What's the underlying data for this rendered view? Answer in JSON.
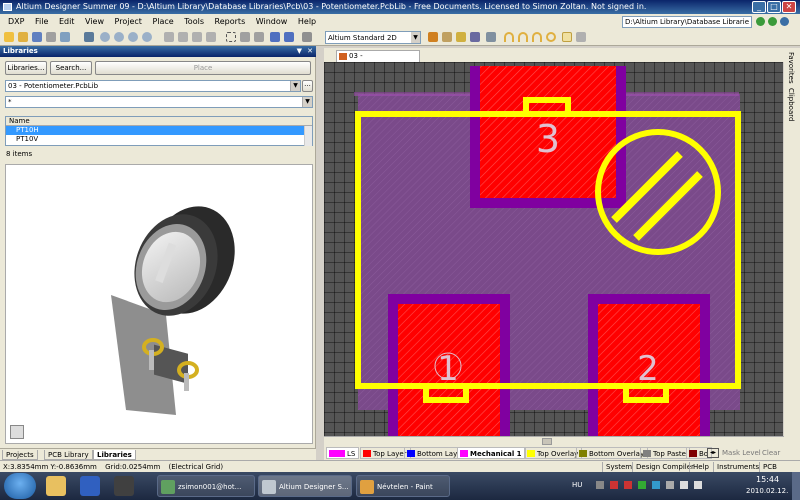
{
  "window": {
    "title": "Altium Designer Summer 09 - D:\\Altium Library\\Database Libraries\\Pcb\\03 - Potentiometer.PcbLib - Free Documents. Licensed to Simon Zoltan. Not signed in.",
    "path_box": "D:\\Altium Library\\Database Librarie"
  },
  "menu": [
    "DXP",
    "File",
    "Edit",
    "View",
    "Project",
    "Place",
    "Tools",
    "Reports",
    "Window",
    "Help"
  ],
  "toolbar": {
    "view_mode": "Altium Standard 2D"
  },
  "libraries_panel": {
    "title": "Libraries",
    "libraries_button": "Libraries...",
    "search_button": "Search...",
    "place_button": "Place",
    "library_select": "03 - Potentiometer.PcbLib",
    "filter_value": "*",
    "list_header": "Name",
    "items": [
      "PT10H",
      "PT10V"
    ],
    "selected_index": 0,
    "count_text": "8 items"
  },
  "panel_tabs": [
    "Projects",
    "PCB Library",
    "Libraries"
  ],
  "document": {
    "tab_label": "03 - Potentiometer.PcbLib"
  },
  "pcb": {
    "pad_labels": [
      "3",
      "1",
      "2"
    ],
    "colors": {
      "background": "#000000",
      "board": "#7a4a8a",
      "top_layer": "#ff0000",
      "overlay": "#ffff00",
      "solder_mask": "#8000a0",
      "grid": "#4a4a4a"
    }
  },
  "right_strip": [
    "Favorites",
    "Clipboard"
  ],
  "layer_tabs": [
    {
      "label": "LS",
      "color": "#ff00ff"
    },
    {
      "label": "Top Layer",
      "color": "#ff0000"
    },
    {
      "label": "Bottom Layer",
      "color": "#0000ff"
    },
    {
      "label": "Mechanical 1",
      "color": "#ff00ff"
    },
    {
      "label": "Top Overlay",
      "color": "#ffff00"
    },
    {
      "label": "Bottom Overlay",
      "color": "#808000"
    },
    {
      "label": "Top Paste",
      "color": "#808080"
    },
    {
      "label": "Bo",
      "color": "#800000"
    }
  ],
  "layer_actions": {
    "mask_level": "Mask Level",
    "clear": "Clear"
  },
  "status": {
    "coords": "X:3.8354mm Y:-0.8636mm",
    "grid": "Grid:0.0254mm",
    "grid_type": "(Electrical Grid)",
    "buttons": [
      "System",
      "Design Compiler",
      "Help",
      "Instruments",
      "PCB"
    ]
  },
  "taskbar": {
    "tasks": [
      "zsimon001@hot...",
      "Altium Designer S...",
      "Névtelen - Paint"
    ],
    "lang": "HU",
    "time": "15:44",
    "date": "2010.02.12."
  }
}
